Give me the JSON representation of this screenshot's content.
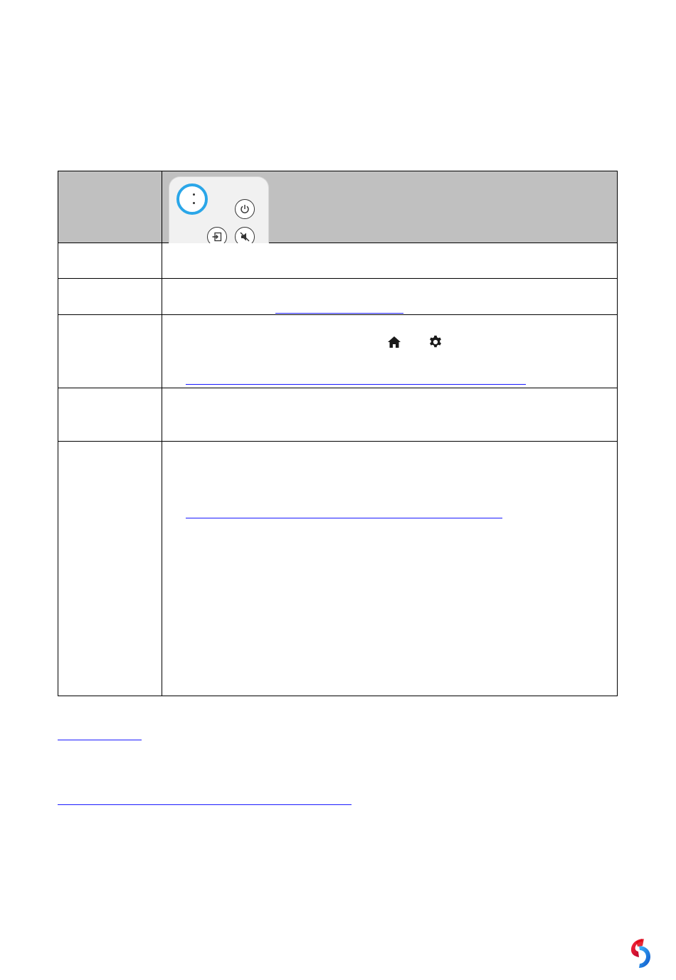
{
  "document": {
    "remote_image": {
      "alt": "",
      "buttons": [
        "power-icon",
        "input-icon",
        "mute-icon"
      ],
      "highlight_color": "#2aa6e8"
    },
    "inline_icons": [
      "home-icon",
      "gear-icon"
    ],
    "link_color": "#1a1aff",
    "brand_colors": [
      "#e30613",
      "#1a8fe3"
    ]
  }
}
